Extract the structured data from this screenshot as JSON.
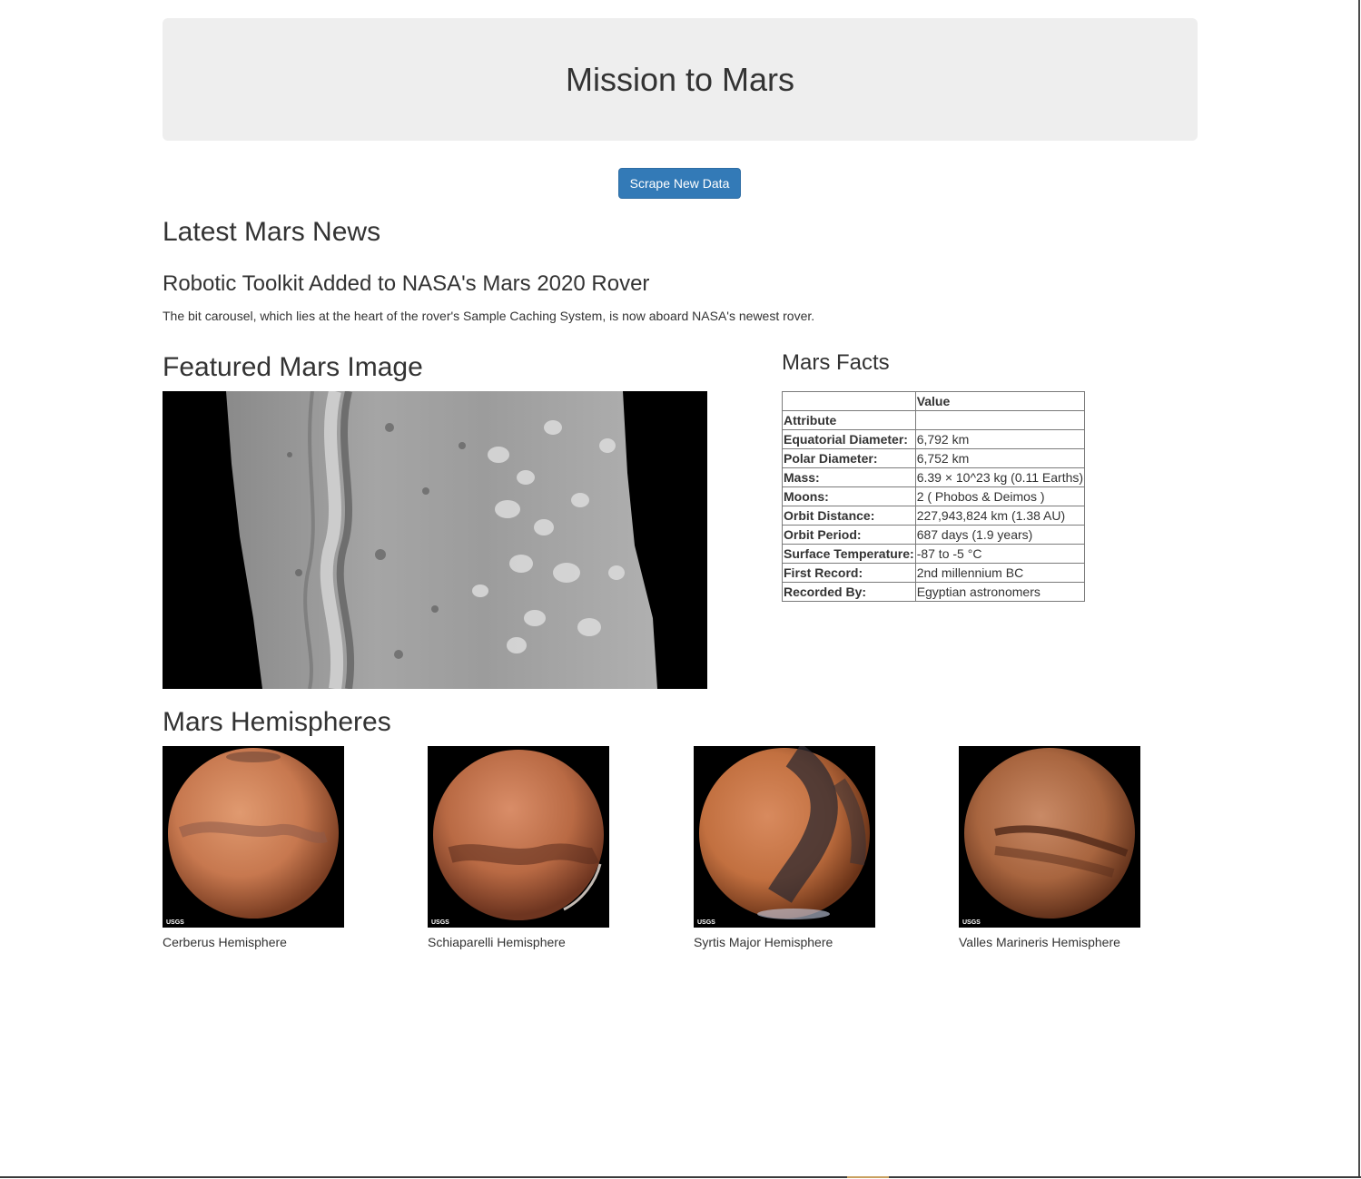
{
  "header": {
    "title": "Mission to Mars"
  },
  "actions": {
    "scrape_label": "Scrape New Data"
  },
  "news": {
    "section_title": "Latest Mars News",
    "headline": "Robotic Toolkit Added to NASA's Mars 2020 Rover",
    "teaser": "The bit carousel, which lies at the heart of the rover's Sample Caching System, is now aboard NASA's newest rover."
  },
  "featured": {
    "section_title": "Featured Mars Image"
  },
  "facts": {
    "section_title": "Mars Facts",
    "value_header": "Value",
    "index_label": "Attribute",
    "rows": [
      {
        "label": "Equatorial Diameter:",
        "value": "6,792 km"
      },
      {
        "label": "Polar Diameter:",
        "value": "6,752 km"
      },
      {
        "label": "Mass:",
        "value": "6.39 × 10^23 kg (0.11 Earths)"
      },
      {
        "label": "Moons:",
        "value": "2 ( Phobos & Deimos )"
      },
      {
        "label": "Orbit Distance:",
        "value": "227,943,824 km (1.38 AU)"
      },
      {
        "label": "Orbit Period:",
        "value": "687 days (1.9 years)"
      },
      {
        "label": "Surface Temperature:",
        "value": "-87 to -5 °C"
      },
      {
        "label": "First Record:",
        "value": "2nd millennium BC"
      },
      {
        "label": "Recorded By:",
        "value": "Egyptian astronomers"
      }
    ]
  },
  "hemispheres": {
    "section_title": "Mars Hemispheres",
    "items": [
      {
        "title": "Cerberus Hemisphere",
        "badge": "USGS"
      },
      {
        "title": "Schiaparelli Hemisphere",
        "badge": "USGS"
      },
      {
        "title": "Syrtis Major Hemisphere",
        "badge": "USGS"
      },
      {
        "title": "Valles Marineris Hemisphere",
        "badge": "USGS"
      }
    ]
  },
  "colors": {
    "button": "#337ab7",
    "jumbotron": "#eeeeee",
    "text": "#333333"
  }
}
